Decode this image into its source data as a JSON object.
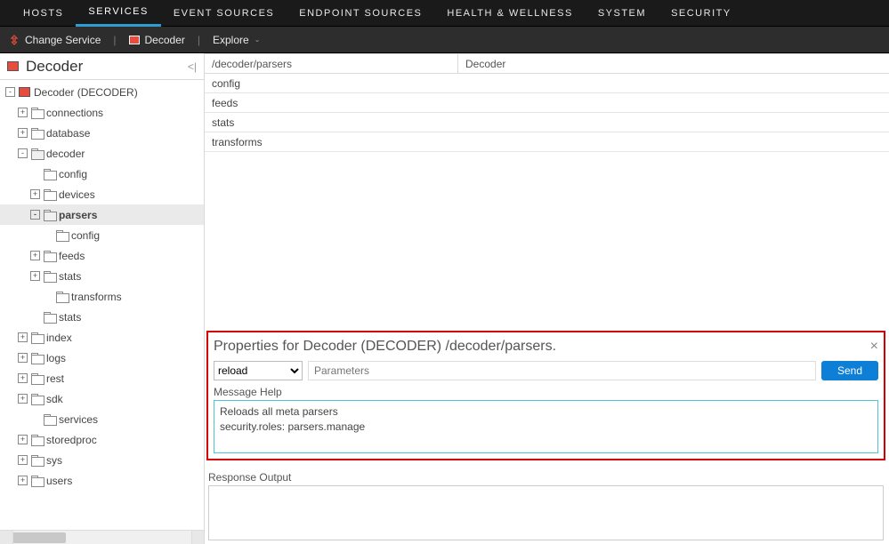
{
  "topnav": {
    "items": [
      {
        "label": "HOSTS"
      },
      {
        "label": "SERVICES"
      },
      {
        "label": "EVENT SOURCES"
      },
      {
        "label": "ENDPOINT SOURCES"
      },
      {
        "label": "HEALTH & WELLNESS"
      },
      {
        "label": "SYSTEM"
      },
      {
        "label": "SECURITY"
      }
    ],
    "active": "SERVICES"
  },
  "subbar": {
    "change_service": "Change Service",
    "decoder": "Decoder",
    "explore": "Explore"
  },
  "sidebar": {
    "title": "Decoder",
    "tree": [
      {
        "label": "Decoder (DECODER)",
        "indent": 0,
        "toggle": "-",
        "icon": "root"
      },
      {
        "label": "connections",
        "indent": 1,
        "toggle": "+",
        "icon": "folder"
      },
      {
        "label": "database",
        "indent": 1,
        "toggle": "+",
        "icon": "folder"
      },
      {
        "label": "decoder",
        "indent": 1,
        "toggle": "-",
        "icon": "folder-open"
      },
      {
        "label": "config",
        "indent": 2,
        "toggle": "",
        "icon": "folder"
      },
      {
        "label": "devices",
        "indent": 2,
        "toggle": "+",
        "icon": "folder"
      },
      {
        "label": "parsers",
        "indent": 2,
        "toggle": "-",
        "icon": "folder-open",
        "selected": true
      },
      {
        "label": "config",
        "indent": 3,
        "toggle": "",
        "icon": "folder"
      },
      {
        "label": "feeds",
        "indent": 2,
        "toggle": "+",
        "icon": "folder"
      },
      {
        "label": "stats",
        "indent": 2,
        "toggle": "+",
        "icon": "folder"
      },
      {
        "label": "transforms",
        "indent": 3,
        "toggle": "",
        "icon": "folder"
      },
      {
        "label": "stats",
        "indent": 2,
        "toggle": "",
        "icon": "folder"
      },
      {
        "label": "index",
        "indent": 1,
        "toggle": "+",
        "icon": "folder"
      },
      {
        "label": "logs",
        "indent": 1,
        "toggle": "+",
        "icon": "folder"
      },
      {
        "label": "rest",
        "indent": 1,
        "toggle": "+",
        "icon": "folder"
      },
      {
        "label": "sdk",
        "indent": 1,
        "toggle": "+",
        "icon": "folder"
      },
      {
        "label": "services",
        "indent": 2,
        "toggle": "",
        "icon": "folder"
      },
      {
        "label": "storedproc",
        "indent": 1,
        "toggle": "+",
        "icon": "folder"
      },
      {
        "label": "sys",
        "indent": 1,
        "toggle": "+",
        "icon": "folder"
      },
      {
        "label": "users",
        "indent": 1,
        "toggle": "+",
        "icon": "folder"
      }
    ]
  },
  "content": {
    "path": "/decoder/parsers",
    "service": "Decoder",
    "items": [
      {
        "label": "config"
      },
      {
        "label": "feeds"
      },
      {
        "label": "stats"
      },
      {
        "label": "transforms"
      }
    ]
  },
  "properties": {
    "title": "Properties for Decoder (DECODER) /decoder/parsers.",
    "command": "reload",
    "params_placeholder": "Parameters",
    "send": "Send",
    "help_label": "Message Help",
    "help_line1": "Reloads all meta parsers",
    "help_line2": "security.roles: parsers.manage",
    "response_label": "Response Output"
  }
}
